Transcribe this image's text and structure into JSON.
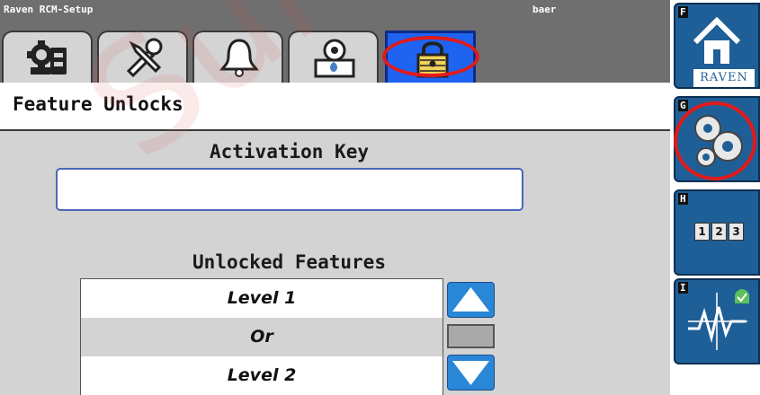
{
  "titlebar": {
    "app_name": "Raven RCM-Setup",
    "user": "baer"
  },
  "tabs": [
    {
      "icon": "machine-setup-icon",
      "active": false
    },
    {
      "icon": "tools-icon",
      "active": false
    },
    {
      "icon": "alarm-bell-icon",
      "active": false
    },
    {
      "icon": "product-control-settings-icon",
      "active": false
    },
    {
      "icon": "lock-icon",
      "active": true
    }
  ],
  "page": {
    "title": "Feature Unlocks"
  },
  "activation": {
    "label": "Activation Key",
    "value": ""
  },
  "unlocked": {
    "label": "Unlocked Features",
    "items": [
      "Level 1",
      "Or",
      "Level 2"
    ]
  },
  "sidebar": {
    "buttons": [
      {
        "key": "F",
        "icon": "home-icon",
        "logo_text": "RAVEN"
      },
      {
        "key": "G",
        "icon": "gear-icon"
      },
      {
        "key": "H",
        "icon": "numeric-keys-icon",
        "digits": [
          "1",
          "2",
          "3"
        ]
      },
      {
        "key": "I",
        "icon": "diagnostics-graph-icon"
      }
    ]
  },
  "watermark": "SurePoint",
  "colors": {
    "titlebar": "#6f6f6f",
    "content_bg": "#d3d3d3",
    "active_tab": "#1e64f0",
    "sidebar_button": "#1f5f97",
    "scroll_button": "#2a86d6",
    "highlight_ring": "#e01b1b"
  }
}
